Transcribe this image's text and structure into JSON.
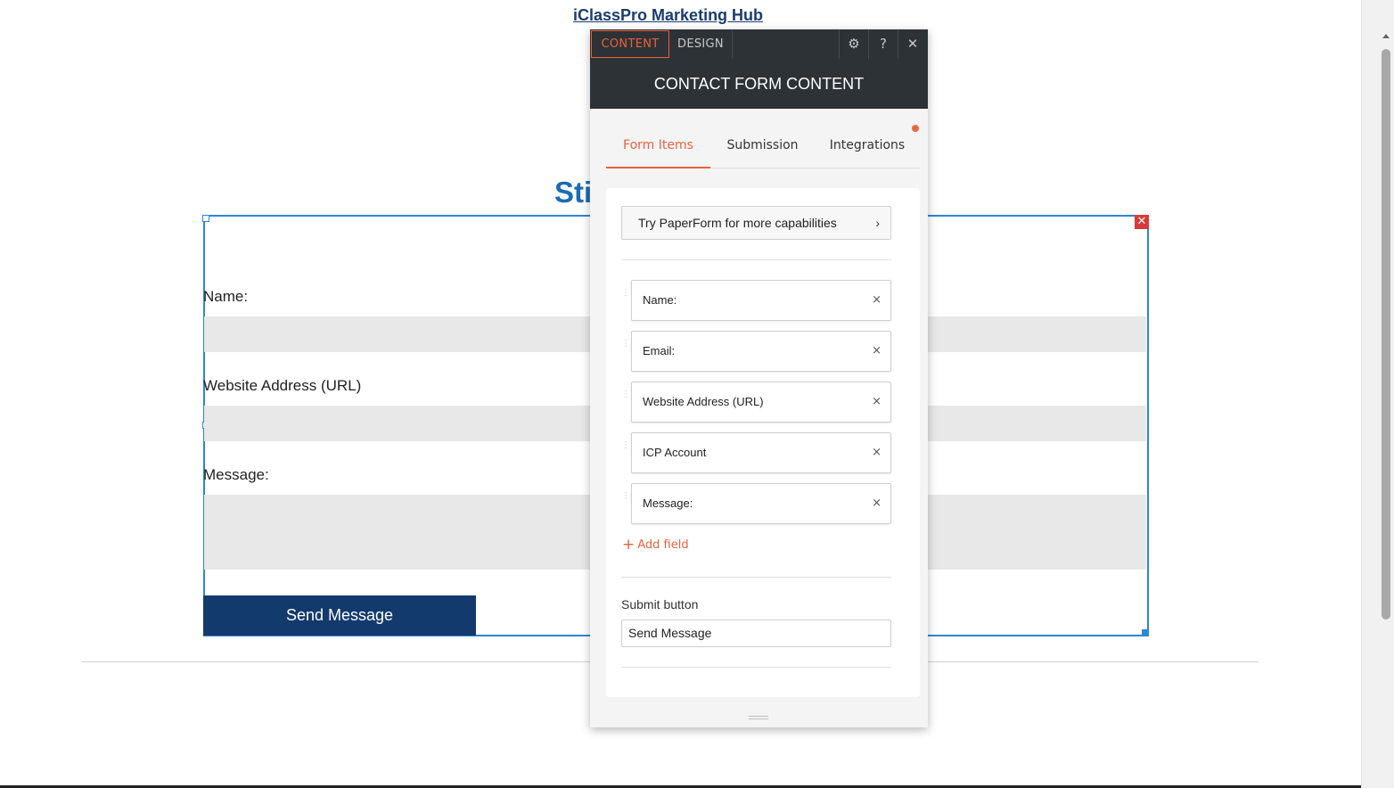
{
  "page": {
    "hub_link": "iClassPro Marketing Hub",
    "heading_partial": "Sti"
  },
  "form_widget": {
    "fields": [
      {
        "label": "Name:"
      },
      {
        "label": "Website Address (URL)"
      },
      {
        "label": "Message:"
      }
    ],
    "send_button": "Send Message",
    "remove_glyph": "✕"
  },
  "panel": {
    "tabs": {
      "content": "CONTENT",
      "design": "DESIGN"
    },
    "toolbar": {
      "settings_icon": "⚙",
      "help": "?",
      "close": "✕"
    },
    "title": "CONTACT FORM CONTENT",
    "subtabs": [
      "Form Items",
      "Submission",
      "Integrations"
    ],
    "notification_color": "#f06543",
    "paperform_button": "Try PaperForm for more capabilities",
    "paperform_chevron": "›",
    "form_items": [
      {
        "label": "Name:"
      },
      {
        "label": "Email:"
      },
      {
        "label": "Website Address (URL)"
      },
      {
        "label": "ICP Account"
      },
      {
        "label": "Message:"
      }
    ],
    "remove_glyph": "×",
    "drag_glyph": "⋮",
    "add_field": "Add field",
    "add_glyph": "+",
    "submit_label": "Submit button",
    "submit_value": "Send Message"
  },
  "colors": {
    "accent": "#e8613a",
    "panel_dark": "#2d3236",
    "form_button": "#133a6d",
    "selection": "#2d86d6"
  }
}
